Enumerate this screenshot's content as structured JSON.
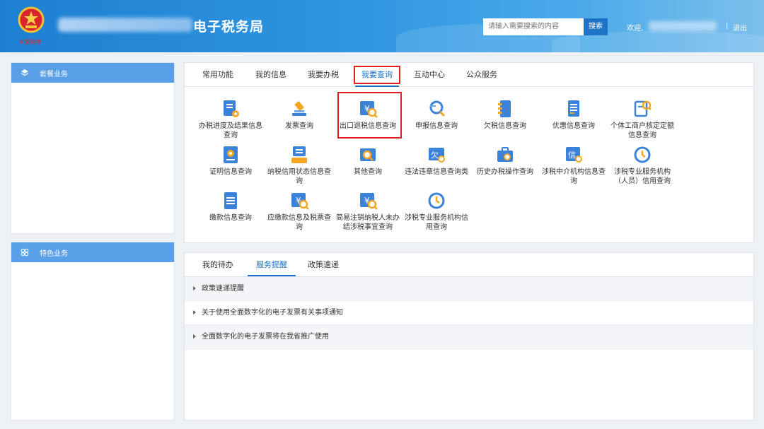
{
  "header": {
    "emblem_caption": "中国税务",
    "site_title": "电子税务局",
    "search_placeholder": "请输入需要搜索的内容",
    "search_button": "搜索",
    "welcome": "欢迎,",
    "separator": "|",
    "logout": "退出"
  },
  "sidebar": {
    "package_title": "套餐业务",
    "feature_title": "特色业务"
  },
  "query_panel": {
    "tabs": [
      "常用功能",
      "我的信息",
      "我要办税",
      "我要查询",
      "互动中心",
      "公众服务"
    ],
    "active_tab": "我要查询",
    "items": [
      {
        "label": "办税进度及结果信息查询",
        "icon": "document-gear-icon"
      },
      {
        "label": "发票查询",
        "icon": "gavel-icon"
      },
      {
        "label": "出口退税信息查询",
        "icon": "yen-search-icon"
      },
      {
        "label": "申报信息查询",
        "icon": "magnifier-icon"
      },
      {
        "label": "欠税信息查询",
        "icon": "ledger-icon"
      },
      {
        "label": "优惠信息查询",
        "icon": "list-document-icon"
      },
      {
        "label": "个体工商户核定定额信息查询",
        "icon": "document-search-icon"
      },
      {
        "label": "证明信息查询",
        "icon": "certificate-icon"
      },
      {
        "label": "纳税信用状态信息查询",
        "icon": "credit-record-icon"
      },
      {
        "label": "其他查询",
        "icon": "search-card-icon"
      },
      {
        "label": "违法违章信息查询类",
        "icon": "violation-icon"
      },
      {
        "label": "历史办税操作查询",
        "icon": "briefcase-search-icon"
      },
      {
        "label": "涉税中介机构信息查询",
        "icon": "credit-search-icon"
      },
      {
        "label": "涉税专业服务机构（人员）信用查询",
        "icon": "clock-history-icon"
      },
      {
        "label": "缴款信息查询",
        "icon": "payment-document-icon"
      },
      {
        "label": "应缴款信息及税票查询",
        "icon": "yen-search-icon"
      },
      {
        "label": "简易注销纳税人未办结涉税事宜查询",
        "icon": "yen-search-icon"
      },
      {
        "label": "涉税专业服务机构信用查询",
        "icon": "clock-history-icon"
      }
    ]
  },
  "notice_panel": {
    "tabs": [
      "我的待办",
      "服务提醒",
      "政策速递"
    ],
    "active_tab": "服务提醒",
    "rows": [
      "政策速递提醒",
      "关于使用全面数字化的电子发票有关事项通知",
      "全面数字化的电子发票将在我省推广使用"
    ]
  },
  "colors": {
    "accent": "#1a6fcf",
    "header_blue": "#2f95e0",
    "sidebar_head": "#5aa0e8",
    "highlight_red": "#e02020"
  }
}
